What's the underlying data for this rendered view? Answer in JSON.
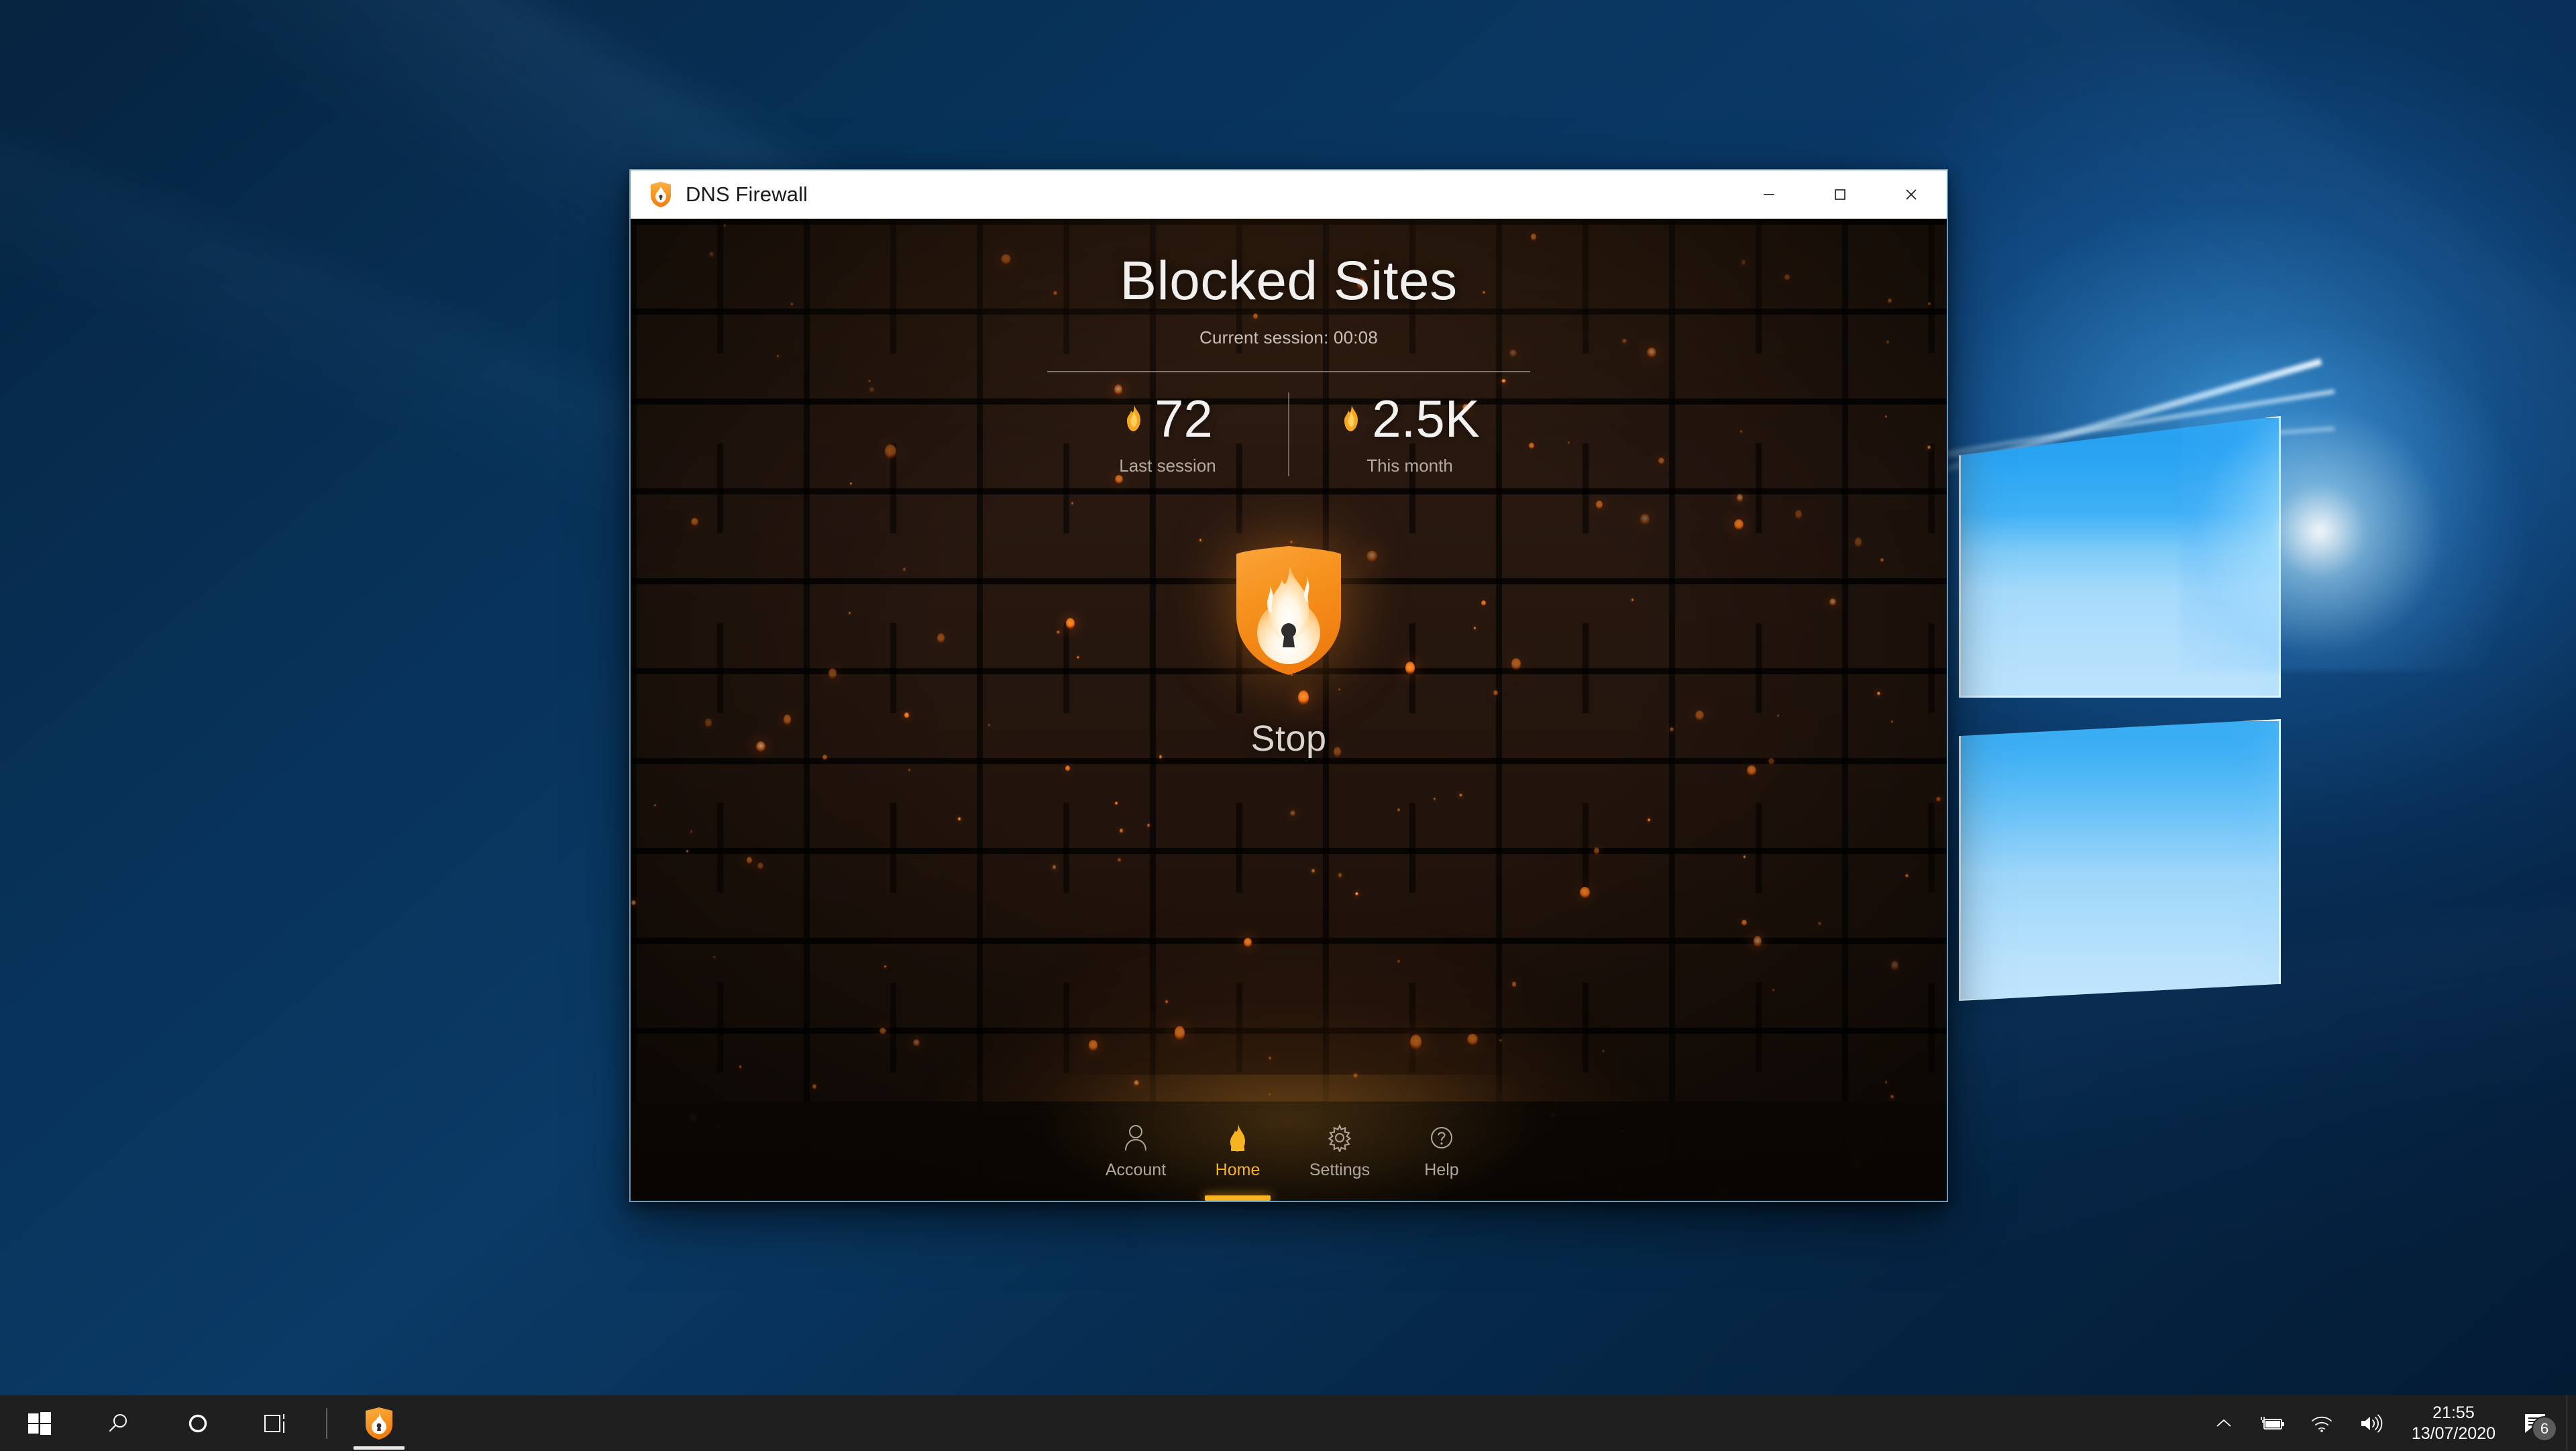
{
  "window": {
    "title": "DNS Firewall",
    "app_icon": "shield-flame-icon",
    "controls": {
      "minimize": "minimize-button",
      "maximize": "maximize-button",
      "close": "close-button"
    }
  },
  "main": {
    "page_title": "Blocked Sites",
    "session_text": "Current session: 00:08",
    "stats": [
      {
        "icon": "flame-icon",
        "value": "72",
        "label": "Last session"
      },
      {
        "icon": "flame-icon",
        "value": "2.5K",
        "label": "This month"
      }
    ],
    "shield": {
      "icon": "shield-flame-lock-icon"
    },
    "action_button": "Stop"
  },
  "nav": {
    "items": [
      {
        "label": "Account",
        "icon": "person-icon",
        "active": false
      },
      {
        "label": "Home",
        "icon": "flame-icon",
        "active": true
      },
      {
        "label": "Settings",
        "icon": "gear-icon",
        "active": false
      },
      {
        "label": "Help",
        "icon": "question-icon",
        "active": false
      }
    ]
  },
  "taskbar": {
    "start": "windows-start-icon",
    "search": "search-icon",
    "cortana": "cortana-icon",
    "task_view": "task-view-icon",
    "pinned_app": "dns-firewall-icon",
    "tray": {
      "chevron": "chevron-up-icon",
      "battery": "battery-charging-icon",
      "wifi": "wifi-icon",
      "volume": "volume-icon",
      "notifications_icon": "notification-icon",
      "notifications_count": "6"
    },
    "clock": {
      "time": "21:55",
      "date": "13/07/2020"
    }
  },
  "colors": {
    "accent_orange": "#f7931e",
    "accent_yellow": "#f7b321",
    "brick_dark": "#1a1009",
    "taskbar": "#1f1f1f",
    "title_bar": "#ffffff",
    "text_primary": "#f2f0ee",
    "text_muted": "#b5aaa0"
  }
}
